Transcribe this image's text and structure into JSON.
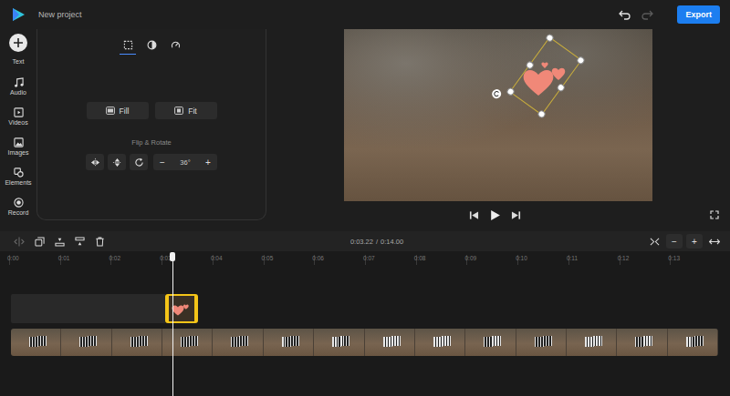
{
  "header": {
    "title": "New project",
    "undo": {
      "disabled": false
    },
    "redo": {
      "disabled": true
    },
    "export": "Export"
  },
  "sidebar": {
    "items": [
      {
        "label": "Text"
      },
      {
        "label": "Audio"
      },
      {
        "label": "Videos"
      },
      {
        "label": "Images"
      },
      {
        "label": "Elements"
      },
      {
        "label": "Record"
      }
    ]
  },
  "panel": {
    "tabs": [
      {
        "selected": true
      },
      {
        "selected": false
      },
      {
        "selected": false
      }
    ],
    "fit_buttons": [
      "Fill",
      "Fit"
    ],
    "section": "Flip & Rotate",
    "rotation": {
      "minus": "−",
      "value": "36°",
      "plus": "+"
    }
  },
  "preview": {
    "sticker": {
      "selected": true
    }
  },
  "timeline": {
    "tools": [
      {
        "disabled": true
      },
      {
        "disabled": false
      },
      {
        "disabled": false
      },
      {
        "disabled": false
      },
      {
        "disabled": false
      }
    ],
    "current": "0:03.22",
    "separator": "/",
    "total": "0:14.00",
    "zoom": {
      "minus": "−",
      "plus": "+"
    },
    "ruler": [
      "0:00",
      "0:01",
      "0:02",
      "0:03",
      "0:04",
      "0:05",
      "0:06",
      "0:07",
      "0:08",
      "0:09",
      "0:10",
      "0:11",
      "0:12",
      "0:13"
    ],
    "tracks": [
      {
        "kind": "sticker",
        "selected": true
      },
      {
        "kind": "video",
        "selected": false
      }
    ]
  }
}
